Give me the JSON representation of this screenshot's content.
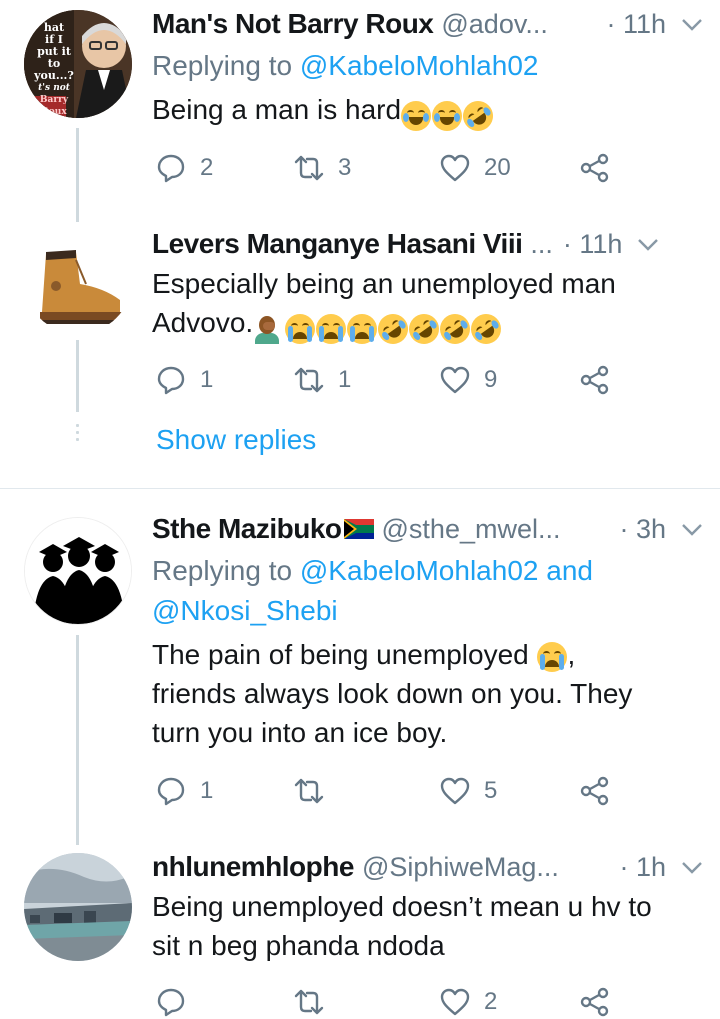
{
  "tweets": [
    {
      "name": "Man's Not Barry Roux",
      "handle": "@adov...",
      "time": "· 11h",
      "replying_prefix": "Replying to ",
      "replying_to": "@KabeloMohlah02",
      "text": "Being a man is hard",
      "avatar_text": [
        "hat",
        "if I",
        "put it",
        "to you...?",
        "t's not",
        "Barry",
        "Roux"
      ],
      "replies": "2",
      "retweets": "3",
      "likes": "20"
    },
    {
      "name": "Levers Manganye Hasani Viii",
      "handle": "...",
      "time": "· 11h",
      "text_line1": "Especially being an unemployed man",
      "text_line2": "Advovo.",
      "replies": "1",
      "retweets": "1",
      "likes": "9"
    },
    {
      "name": "Sthe Mazibuko",
      "handle": "@sthe_mwel...",
      "time": "· 3h",
      "replying_prefix": "Replying to ",
      "replying_to": "@KabeloMohlah02 and",
      "replying_to_2": "@Nkosi_Shebi",
      "text_line1": "The pain of being unemployed",
      "text_line1_end": ",",
      "text_line2": "friends always look down on you. They",
      "text_line3": "turn you into an ice boy.",
      "replies": "1",
      "retweets": "",
      "likes": "5"
    },
    {
      "name": "nhlunemhlophe",
      "handle": "@SiphiweMag...",
      "time": "· 1h",
      "text_line1": "Being unemployed doesn’t mean u hv to",
      "text_line2": "sit n beg phanda ndoda",
      "replies": "",
      "retweets": "",
      "likes": "2"
    }
  ],
  "show_replies": "Show replies",
  "colors": {
    "accent": "#1da1f2",
    "muted": "#657786",
    "text": "#14171a",
    "line": "#cfd9de"
  }
}
